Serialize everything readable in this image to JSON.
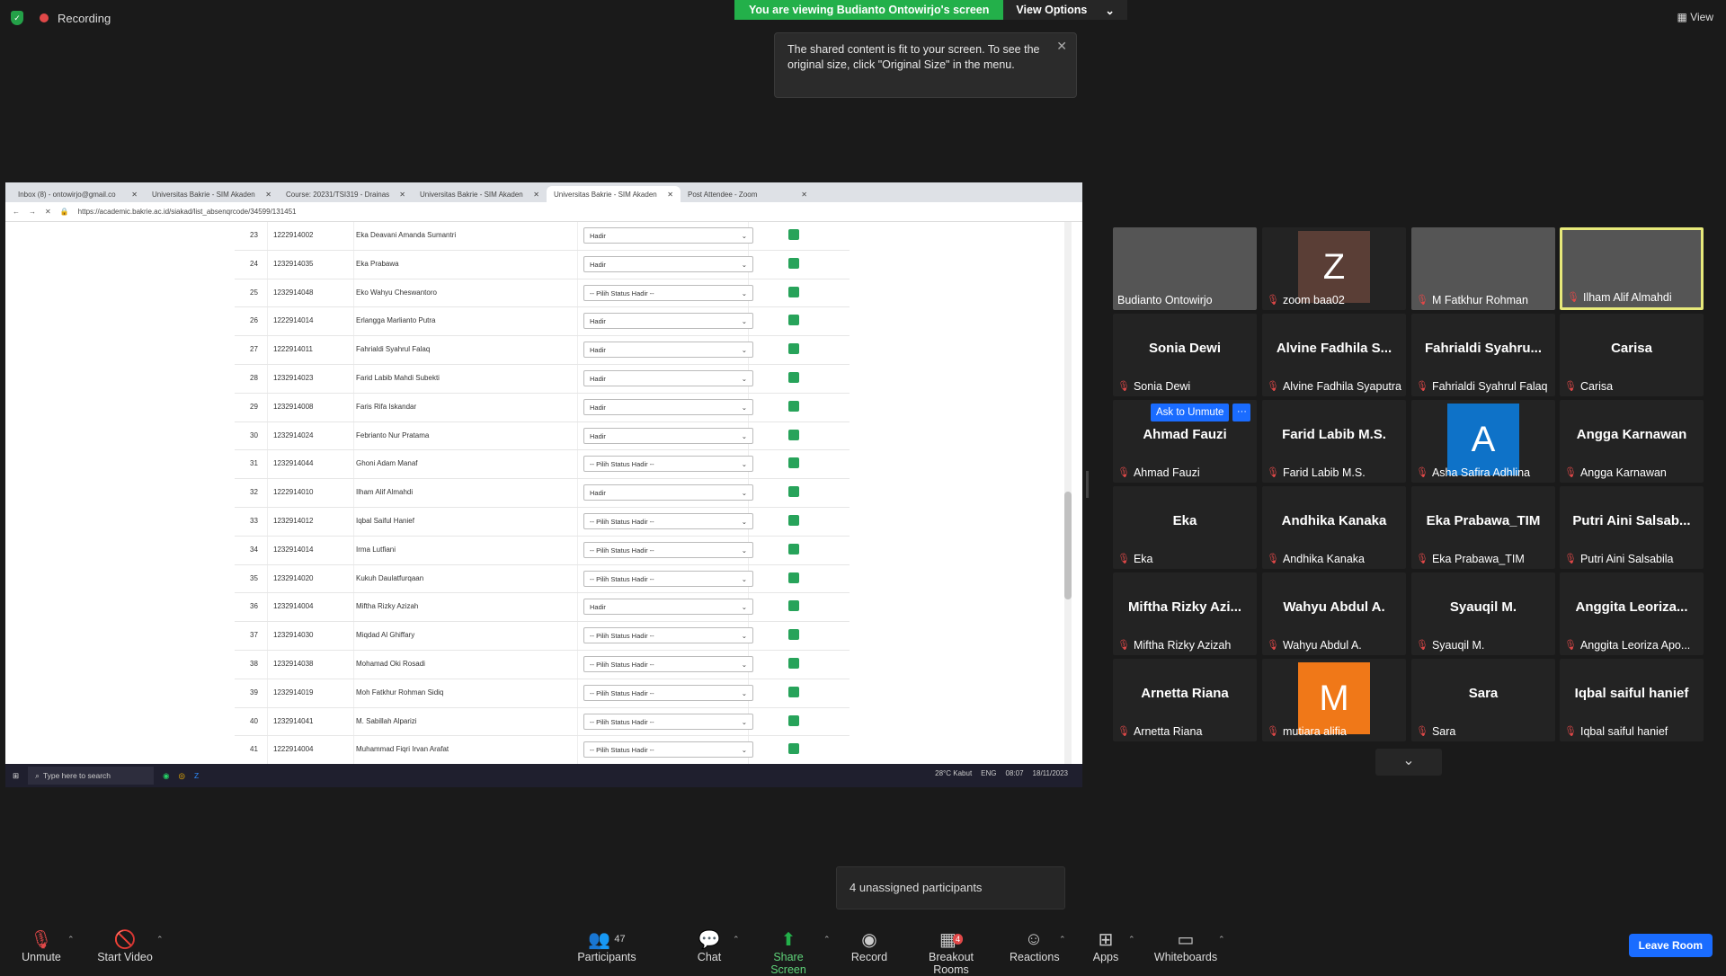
{
  "top": {
    "recording": "Recording",
    "banner": "You are viewing Budianto Ontowirjo's screen",
    "view_options": "View Options",
    "view": "View"
  },
  "tooltip": "The shared content is fit to your screen. To see the original size, click \"Original Size\" in the menu.",
  "browser": {
    "tabs": [
      "Inbox (8) - ontowirjo@gmail.co",
      "Universitas Bakrie - SIM Akaden",
      "Course: 20231/TSI319 - Drainas",
      "Universitas Bakrie - SIM Akaden",
      "Universitas Bakrie - SIM Akaden",
      "Post Attendee - Zoom"
    ],
    "url": "https://academic.bakrie.ac.id/siakad/list_absenqrcode/34599/131451"
  },
  "rows": [
    {
      "no": "23",
      "nim": "1222914002",
      "name": "Eka Deavani Amanda Sumantri",
      "status": "Hadir"
    },
    {
      "no": "24",
      "nim": "1232914035",
      "name": "Eka Prabawa",
      "status": "Hadir"
    },
    {
      "no": "25",
      "nim": "1232914048",
      "name": "Eko Wahyu Cheswantoro",
      "status": "-- Pilih Status Hadir --"
    },
    {
      "no": "26",
      "nim": "1222914014",
      "name": "Erlangga Marlianto Putra",
      "status": "Hadir"
    },
    {
      "no": "27",
      "nim": "1222914011",
      "name": "Fahrialdi Syahrul Falaq",
      "status": "Hadir"
    },
    {
      "no": "28",
      "nim": "1232914023",
      "name": "Farid Labib Mahdi Subekti",
      "status": "Hadir"
    },
    {
      "no": "29",
      "nim": "1232914008",
      "name": "Faris Rifa Iskandar",
      "status": "Hadir"
    },
    {
      "no": "30",
      "nim": "1232914024",
      "name": "Febrianto Nur Pratama",
      "status": "Hadir"
    },
    {
      "no": "31",
      "nim": "1232914044",
      "name": "Ghoni Adam Manaf",
      "status": "-- Pilih Status Hadir --"
    },
    {
      "no": "32",
      "nim": "1222914010",
      "name": "Ilham Alif Almahdi",
      "status": "Hadir"
    },
    {
      "no": "33",
      "nim": "1232914012",
      "name": "Iqbal Saiful Hanief",
      "status": "-- Pilih Status Hadir --"
    },
    {
      "no": "34",
      "nim": "1232914014",
      "name": "Irma Lutfiani",
      "status": "-- Pilih Status Hadir --"
    },
    {
      "no": "35",
      "nim": "1232914020",
      "name": "Kukuh Daulatfurqaan",
      "status": "-- Pilih Status Hadir --"
    },
    {
      "no": "36",
      "nim": "1232914004",
      "name": "Miftha Rizky Azizah",
      "status": "Hadir"
    },
    {
      "no": "37",
      "nim": "1232914030",
      "name": "Miqdad Al Ghiffary",
      "status": "-- Pilih Status Hadir --"
    },
    {
      "no": "38",
      "nim": "1232914038",
      "name": "Mohamad Oki Rosadi",
      "status": "-- Pilih Status Hadir --"
    },
    {
      "no": "39",
      "nim": "1232914019",
      "name": "Moh Fatkhur Rohman Sidiq",
      "status": "-- Pilih Status Hadir --"
    },
    {
      "no": "40",
      "nim": "1232914041",
      "name": "M. Sabillah Alparizi",
      "status": "-- Pilih Status Hadir --"
    },
    {
      "no": "41",
      "nim": "1222914004",
      "name": "Muhammad Fiqri Irvan Arafat",
      "status": "-- Pilih Status Hadir --"
    }
  ],
  "taskbar": {
    "search": "Type here to search",
    "weather": "28°C  Kabut",
    "lang": "ENG",
    "time": "08:07",
    "date": "18/11/2023"
  },
  "gallery": [
    {
      "big": "",
      "label": "Budianto Ontowirjo",
      "type": "video",
      "muted": false
    },
    {
      "big": "",
      "label": "zoom baa02",
      "type": "avatar",
      "letter": "Z",
      "color": "#5a3e36",
      "muted": true
    },
    {
      "big": "",
      "label": "M Fatkhur Rohman",
      "type": "video",
      "muted": true
    },
    {
      "big": "",
      "label": "Ilham Alif Almahdi",
      "type": "video",
      "muted": true,
      "hl": true
    },
    {
      "big": "Sonia Dewi",
      "label": "Sonia Dewi",
      "muted": true
    },
    {
      "big": "Alvine Fadhila S...",
      "label": "Alvine Fadhila Syaputra",
      "muted": true
    },
    {
      "big": "Fahrialdi  Syahru...",
      "label": "Fahrialdi Syahrul Falaq",
      "muted": true
    },
    {
      "big": "Carisa",
      "label": "Carisa",
      "muted": true
    },
    {
      "big": "Ahmad Fauzi",
      "label": "Ahmad Fauzi",
      "muted": true,
      "ask": true
    },
    {
      "big": "Farid Labib M.S.",
      "label": "Farid Labib M.S.",
      "muted": true
    },
    {
      "big": "",
      "label": "Asha Safira Adhlina",
      "type": "avatar",
      "letter": "A",
      "color": "#0e72c8",
      "muted": true
    },
    {
      "big": "Angga Karnawan",
      "label": "Angga Karnawan",
      "muted": true
    },
    {
      "big": "Eka",
      "label": "Eka",
      "muted": true
    },
    {
      "big": "Andhika Kanaka",
      "label": "Andhika Kanaka",
      "muted": true
    },
    {
      "big": "Eka Prabawa_TIM",
      "label": "Eka Prabawa_TIM",
      "muted": true
    },
    {
      "big": "Putri Aini Salsab...",
      "label": "Putri Aini Salsabila",
      "muted": true
    },
    {
      "big": "Miftha  Rizky  Azi...",
      "label": "Miftha Rizky Azizah",
      "muted": true
    },
    {
      "big": "Wahyu Abdul A.",
      "label": "Wahyu Abdul A.",
      "muted": true
    },
    {
      "big": "Syauqil M.",
      "label": "Syauqil M.",
      "muted": true
    },
    {
      "big": "Anggita  Leoriza...",
      "label": "Anggita Leoriza Apo...",
      "muted": true
    },
    {
      "big": "Arnetta Riana",
      "label": "Arnetta Riana",
      "muted": true
    },
    {
      "big": "",
      "label": "mutiara alifia",
      "type": "avatar",
      "letter": "M",
      "color": "#f07818",
      "muted": true
    },
    {
      "big": "Sara",
      "label": "Sara",
      "muted": true
    },
    {
      "big": "Iqbal saiful hanief",
      "label": "Iqbal saiful hanief",
      "muted": true
    }
  ],
  "ask_unmute": "Ask to Unmute",
  "unassigned": "4 unassigned participants",
  "toolbar": {
    "unmute": "Unmute",
    "start_video": "Start Video",
    "participants": "Participants",
    "participants_count": "47",
    "chat": "Chat",
    "share": "Share Screen",
    "record": "Record",
    "breakout": "Breakout Rooms",
    "breakout_badge": "4",
    "reactions": "Reactions",
    "apps": "Apps",
    "whiteboards": "Whiteboards",
    "leave": "Leave Room"
  }
}
